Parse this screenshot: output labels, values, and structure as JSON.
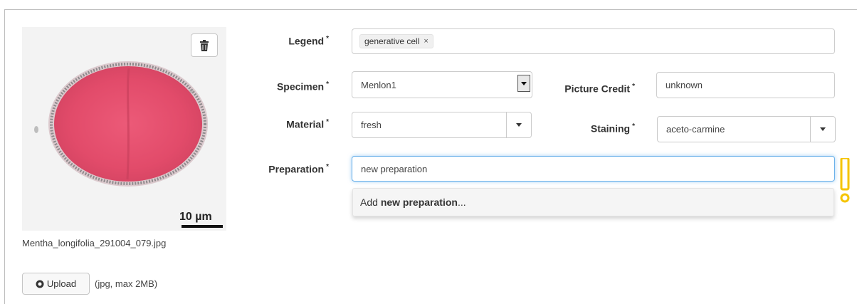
{
  "image": {
    "filename": "Mentha_longifolia_291004_079.jpg",
    "scale_label": "10 µm",
    "delete_icon": "trash-icon"
  },
  "upload": {
    "button_label": "Upload",
    "hint": "(jpg, max 2MB)",
    "icon": "upload-circle-icon"
  },
  "form": {
    "required_mark": "*",
    "legend": {
      "label": "Legend",
      "tags": [
        "generative cell"
      ],
      "tag_remove": "×"
    },
    "specimen": {
      "label": "Specimen",
      "value": "Menlon1"
    },
    "picture_credit": {
      "label": "Picture Credit",
      "value": "unknown"
    },
    "material": {
      "label": "Material",
      "value": "fresh"
    },
    "staining": {
      "label": "Staining",
      "value": "aceto-carmine"
    },
    "preparation": {
      "label": "Preparation",
      "value": "new preparation",
      "suggestion_prefix": "Add ",
      "suggestion_bold": "new preparation",
      "suggestion_suffix": "..."
    }
  },
  "colors": {
    "focus": "#66afe9",
    "warning": "#f5c400",
    "cell_fill": "#e0506e"
  }
}
